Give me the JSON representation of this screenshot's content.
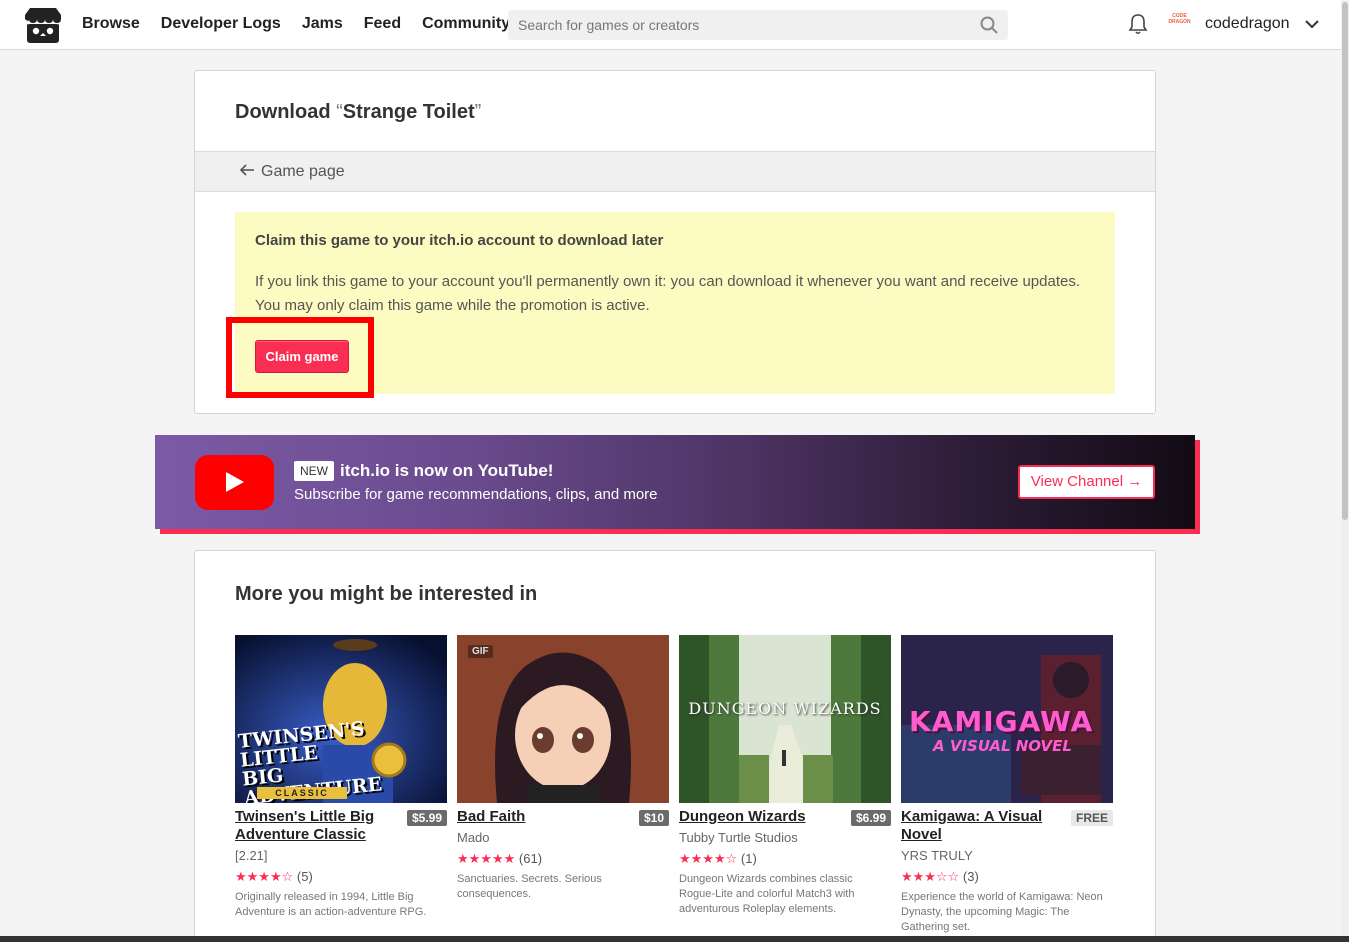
{
  "header": {
    "nav": [
      "Browse",
      "Developer Logs",
      "Jams",
      "Feed",
      "Community"
    ],
    "search_placeholder": "Search for games or creators",
    "username": "codedragon",
    "avatar_text": "CODE DRAGON"
  },
  "download": {
    "title_prefix": "Download ",
    "title_open_quote": "“",
    "game_name": "Strange Toilet",
    "title_close_quote": "”",
    "back_link": "Game page",
    "claim_title": "Claim this game to your itch.io account to download later",
    "claim_description": "If you link this game to your account you'll permanently own it: you can download it whenever you want and receive updates. You may only claim this game while the promotion is active.",
    "claim_button": "Claim game"
  },
  "youtube_banner": {
    "badge": "NEW",
    "headline": "itch.io is now on YouTube!",
    "subtitle": "Subscribe for game recommendations, clips, and more",
    "button": "View Channel →"
  },
  "recommendations": {
    "title": "More you might be interested in",
    "games": [
      {
        "title": "Twinsen's Little Big Adventure Classic",
        "price": "$5.99",
        "author": "[2.21]",
        "stars": 4.5,
        "star_text": "★★★★☆",
        "rating_count": "(5)",
        "description": "Originally released in 1994, Little Big Adventure is an action-adventure RPG.",
        "cover_text": "TWINSEN'S LITTLE BIG ADVENTURE",
        "cover_sub": "CLASSIC"
      },
      {
        "title": "Bad Faith",
        "price": "$10",
        "author": "Mado",
        "stars": 5,
        "star_text": "★★★★★",
        "rating_count": "(61)",
        "description": "Sanctuaries. Secrets. Serious consequences.",
        "badge": "GIF"
      },
      {
        "title": "Dungeon Wizards",
        "price": "$6.99",
        "author": "Tubby Turtle Studios",
        "stars": 4,
        "star_text": "★★★★☆",
        "rating_count": "(1)",
        "description": "Dungeon Wizards combines classic Rogue-Lite and colorful Match3 with adventurous Roleplay elements.",
        "cover_text": "DUNGEON WIZARDS"
      },
      {
        "title": "Kamigawa: A Visual Novel",
        "price": "FREE",
        "author": "YRS TRULY",
        "stars": 3,
        "star_text": "★★★☆☆",
        "rating_count": "(3)",
        "description": "Experience the world of Kamigawa: Neon Dynasty, the upcoming Magic: The Gathering set.",
        "cover_text": "KAMIGAWA",
        "cover_sub": "A VISUAL NOVEL"
      }
    ]
  },
  "colors": {
    "accent": "#fa2e53",
    "claim_bg": "#fcfcc2",
    "highlight": "#ff0000",
    "youtube_red": "#ff0000"
  },
  "icons": [
    "itchio-logo-icon",
    "search-icon",
    "bell-icon",
    "chevron-down-icon",
    "arrow-left-icon",
    "youtube-play-icon"
  ]
}
